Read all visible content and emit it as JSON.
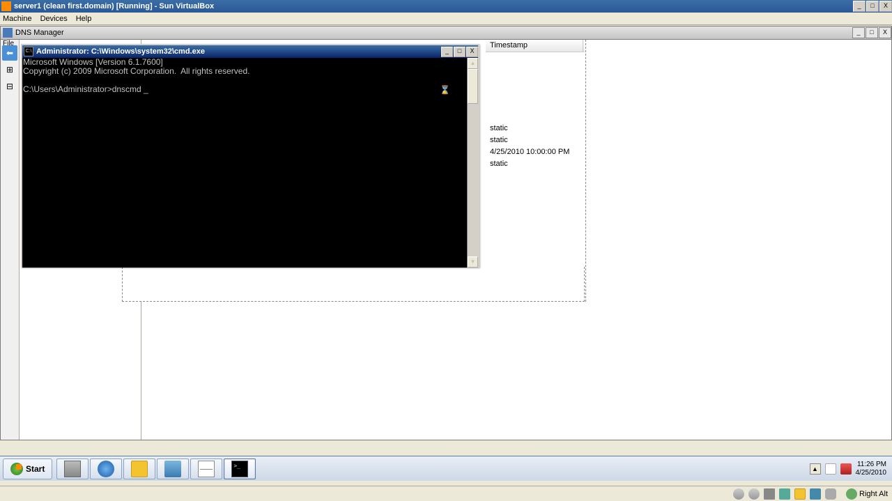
{
  "vbox": {
    "title": "server1 (clean first.domain) [Running] - Sun VirtualBox",
    "menu": {
      "machine": "Machine",
      "devices": "Devices",
      "help": "Help"
    },
    "win": {
      "min": "_",
      "max": "□",
      "close": "X"
    },
    "status": {
      "hostkey": "Right Alt"
    }
  },
  "dns": {
    "title": "DNS Manager",
    "menu_file": "File",
    "col_header": "Timestamp",
    "rows": [
      "static",
      "static",
      "4/25/2010 10:00:00 PM",
      "static"
    ],
    "win": {
      "min": "_",
      "max": "□",
      "close": "X"
    }
  },
  "cmd": {
    "title": "Administrator: C:\\Windows\\system32\\cmd.exe",
    "line1": "Microsoft Windows [Version 6.1.7600]",
    "line2": "Copyright (c) 2009 Microsoft Corporation.  All rights reserved.",
    "prompt": "C:\\Users\\Administrator>dnscmd _",
    "win": {
      "min": "_",
      "max": "□",
      "close": "X"
    }
  },
  "taskbar": {
    "start": "Start",
    "tray": {
      "time": "11:26 PM",
      "date": "4/25/2010"
    }
  }
}
